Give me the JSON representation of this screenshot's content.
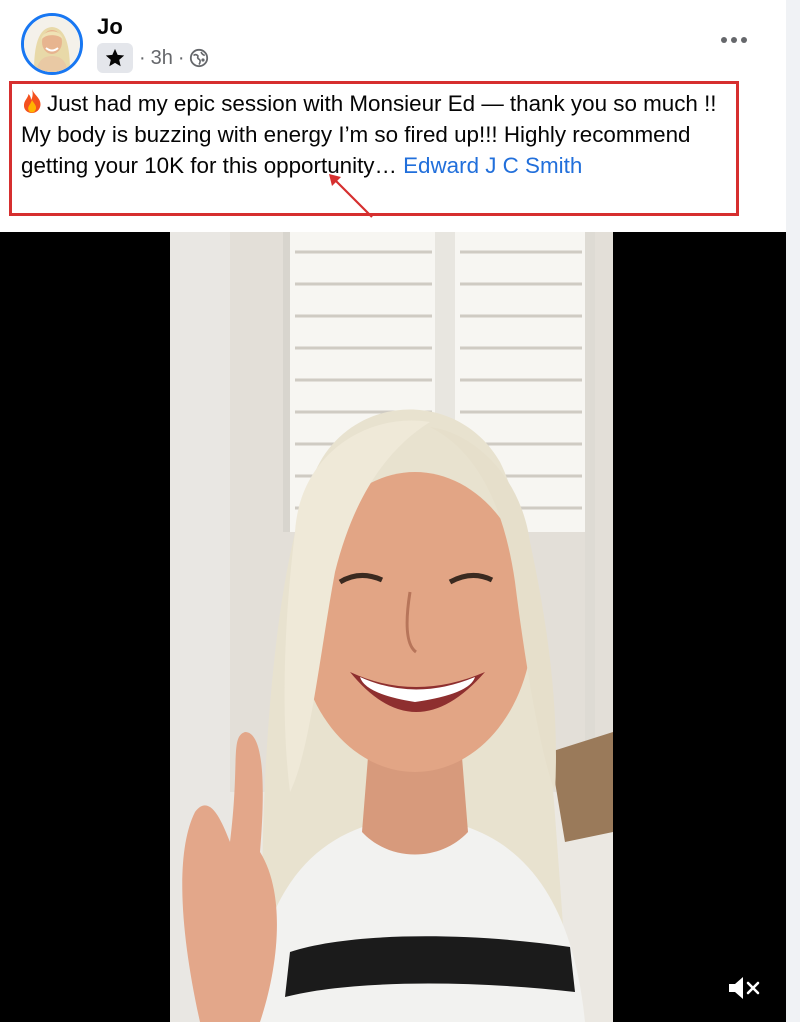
{
  "post": {
    "author": "Jo",
    "time": "3h",
    "separator": "·",
    "icons": {
      "avatar": "profile-photo",
      "badge": "star-icon",
      "privacy": "globe-icon",
      "more": "more-options-icon",
      "emoji": "fire-emoji",
      "mute": "volume-muted-icon"
    },
    "caption": {
      "text": "Just had my epic session with Monsieur Ed — thank you so much !! My body is buzzing with energy I’m so fired up!!! Highly recommend getting your 10K for this opportunity… ",
      "mention": "Edward J C Smith"
    },
    "annotation_color": "#d62f2f",
    "link_color": "#216fdb"
  }
}
